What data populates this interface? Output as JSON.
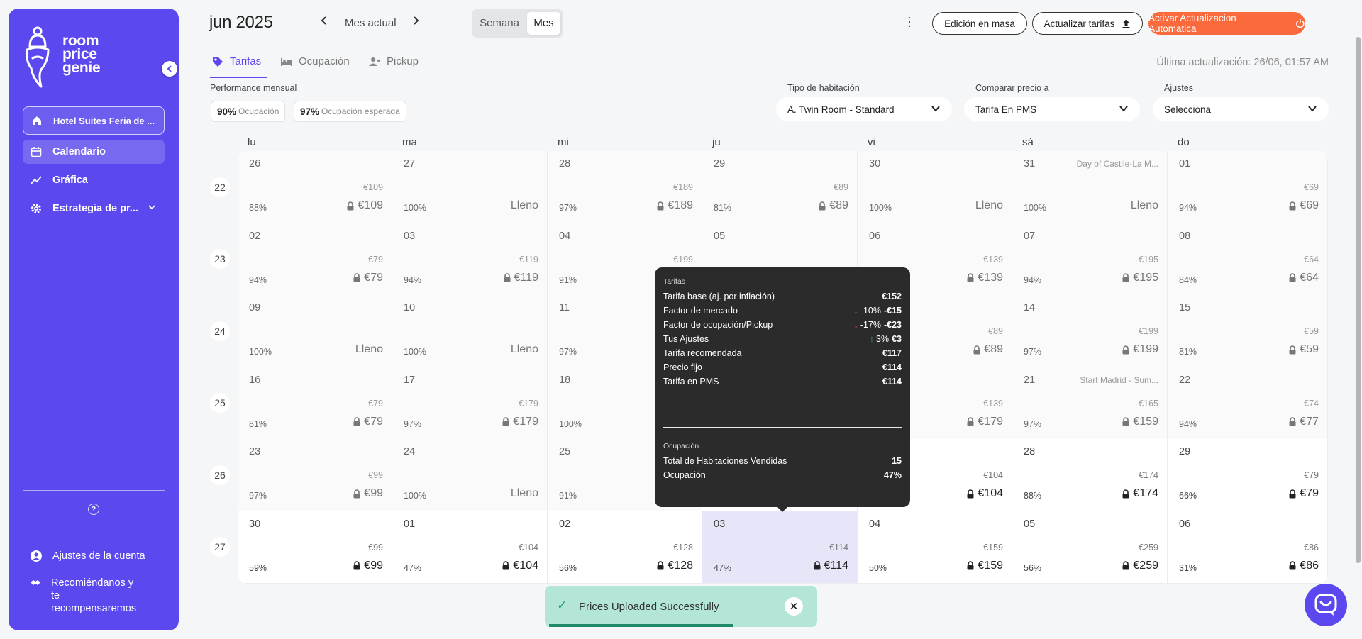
{
  "brand": {
    "lines": [
      "room",
      "price",
      "genie"
    ]
  },
  "sidebar": {
    "hotel": "Hotel Suites Feria de ...",
    "items": [
      {
        "label": "Calendario",
        "icon": "calendar-icon"
      },
      {
        "label": "Gráfica",
        "icon": "chart-line-icon"
      },
      {
        "label": "Estrategia de pr...",
        "icon": "gear-icon"
      }
    ],
    "bottom": [
      {
        "label": "Ajustes de la cuenta",
        "icon": "user-circle-icon"
      },
      {
        "label": "Recomiéndanos y te recompensaremos",
        "icon": "handshake-icon"
      }
    ],
    "help_glyph": "?"
  },
  "header": {
    "month": "jun 2025",
    "current_month": "Mes actual",
    "views": [
      "Semana",
      "Mes"
    ],
    "active_view": "Mes",
    "buttons": {
      "bulk_edit": "Edición en masa",
      "update_rates": "Actualizar tarifas",
      "auto_update": "Activar Actualizacion Automatica"
    },
    "last_update": "Última actualización: 26/06, 01:57 AM"
  },
  "tabs": [
    {
      "label": "Tarifas",
      "icon": "tag-icon"
    },
    {
      "label": "Ocupación",
      "icon": "bed-icon"
    },
    {
      "label": "Pickup",
      "icon": "user-plus-icon"
    }
  ],
  "filters": {
    "performance_label": "Performance mensual",
    "occupancy": {
      "value": "90%",
      "label": "Ocupación"
    },
    "expected_occupancy": {
      "value": "97%",
      "label": "Ocupación esperada"
    },
    "room_type": {
      "label": "Tipo de habitación",
      "value": "A. Twin Room - Standard"
    },
    "compare": {
      "label": "Comparar precio a",
      "value": "Tarifa En PMS"
    },
    "settings": {
      "label": "Ajustes",
      "value": "Selecciona"
    }
  },
  "calendar": {
    "day_names": [
      "lu",
      "ma",
      "mi",
      "ju",
      "vi",
      "sá",
      "do"
    ],
    "weeks": [
      {
        "num": "22",
        "days": [
          {
            "d": "26",
            "pms": "€109",
            "occ": "88%",
            "price": "€109",
            "lock": true,
            "past": true
          },
          {
            "d": "27",
            "pms": "",
            "occ": "100%",
            "price": "Lleno",
            "lock": false,
            "past": true
          },
          {
            "d": "28",
            "pms": "€189",
            "occ": "97%",
            "price": "€189",
            "lock": true,
            "past": true
          },
          {
            "d": "29",
            "pms": "€89",
            "occ": "81%",
            "price": "€89",
            "lock": true,
            "past": true
          },
          {
            "d": "30",
            "pms": "",
            "occ": "100%",
            "price": "Lleno",
            "lock": false,
            "past": true
          },
          {
            "d": "31",
            "pms": "",
            "occ": "100%",
            "price": "Lleno",
            "lock": false,
            "past": true,
            "event": "Day of Castile-La M..."
          },
          {
            "d": "01",
            "pms": "€69",
            "occ": "94%",
            "price": "€69",
            "lock": true,
            "past": true
          }
        ]
      },
      {
        "num": "23",
        "days": [
          {
            "d": "02",
            "pms": "€79",
            "occ": "94%",
            "price": "€79",
            "lock": true,
            "past": true
          },
          {
            "d": "03",
            "pms": "€119",
            "occ": "94%",
            "price": "€119",
            "lock": true,
            "past": true
          },
          {
            "d": "04",
            "pms": "€199",
            "occ": "91%",
            "price": "",
            "lock": false,
            "past": true
          },
          {
            "d": "05",
            "pms": "",
            "occ": "",
            "price": "",
            "lock": false,
            "past": true
          },
          {
            "d": "06",
            "pms": "€139",
            "occ": "",
            "price": "€139",
            "lock": true,
            "past": true
          },
          {
            "d": "07",
            "pms": "€195",
            "occ": "94%",
            "price": "€195",
            "lock": true,
            "past": true
          },
          {
            "d": "08",
            "pms": "€64",
            "occ": "84%",
            "price": "€64",
            "lock": true,
            "past": true
          }
        ]
      },
      {
        "num": "24",
        "days": [
          {
            "d": "09",
            "pms": "",
            "occ": "100%",
            "price": "Lleno",
            "lock": false,
            "past": true
          },
          {
            "d": "10",
            "pms": "",
            "occ": "100%",
            "price": "Lleno",
            "lock": false,
            "past": true
          },
          {
            "d": "11",
            "pms": "",
            "occ": "97%",
            "price": "",
            "lock": false,
            "past": true
          },
          {
            "d": "",
            "pms": "",
            "occ": "",
            "price": "",
            "lock": false,
            "past": true
          },
          {
            "d": "",
            "pms": "€89",
            "occ": "",
            "price": "€89",
            "lock": true,
            "past": true
          },
          {
            "d": "14",
            "pms": "€199",
            "occ": "97%",
            "price": "€199",
            "lock": true,
            "past": true
          },
          {
            "d": "15",
            "pms": "€59",
            "occ": "81%",
            "price": "€59",
            "lock": true,
            "past": true
          }
        ]
      },
      {
        "num": "25",
        "days": [
          {
            "d": "16",
            "pms": "€79",
            "occ": "81%",
            "price": "€79",
            "lock": true,
            "past": true
          },
          {
            "d": "17",
            "pms": "€179",
            "occ": "97%",
            "price": "€179",
            "lock": true,
            "past": true
          },
          {
            "d": "18",
            "pms": "",
            "occ": "100%",
            "price": "",
            "lock": false,
            "past": true
          },
          {
            "d": "",
            "pms": "",
            "occ": "",
            "price": "",
            "lock": false,
            "past": true
          },
          {
            "d": "",
            "pms": "€139",
            "occ": "",
            "price": "€179",
            "lock": true,
            "past": true
          },
          {
            "d": "21",
            "pms": "€165",
            "occ": "97%",
            "price": "€159",
            "lock": true,
            "past": true,
            "event": "Start Madrid - Sum..."
          },
          {
            "d": "22",
            "pms": "€74",
            "occ": "94%",
            "price": "€77",
            "lock": true,
            "past": true
          }
        ]
      },
      {
        "num": "26",
        "days": [
          {
            "d": "23",
            "pms": "€99",
            "occ": "97%",
            "price": "€99",
            "lock": true,
            "past": true
          },
          {
            "d": "24",
            "pms": "",
            "occ": "100%",
            "price": "Lleno",
            "lock": false,
            "past": true
          },
          {
            "d": "25",
            "pms": "",
            "occ": "91%",
            "price": "",
            "lock": false,
            "past": true
          },
          {
            "d": "",
            "pms": "",
            "occ": "",
            "price": "",
            "lock": false,
            "past": false
          },
          {
            "d": "",
            "pms": "€104",
            "occ": "",
            "price": "€104",
            "lock": true,
            "past": false
          },
          {
            "d": "28",
            "pms": "€174",
            "occ": "88%",
            "price": "€174",
            "lock": true,
            "past": false
          },
          {
            "d": "29",
            "pms": "€79",
            "occ": "66%",
            "price": "€79",
            "lock": true,
            "past": false
          }
        ]
      },
      {
        "num": "27",
        "days": [
          {
            "d": "30",
            "pms": "€99",
            "occ": "59%",
            "price": "€99",
            "lock": true,
            "past": false
          },
          {
            "d": "01",
            "pms": "€104",
            "occ": "47%",
            "price": "€104",
            "lock": true,
            "past": false
          },
          {
            "d": "02",
            "pms": "€128",
            "occ": "56%",
            "price": "€128",
            "lock": true,
            "past": false
          },
          {
            "d": "03",
            "pms": "€114",
            "occ": "47%",
            "price": "€114",
            "lock": true,
            "past": false,
            "selected": true
          },
          {
            "d": "04",
            "pms": "€159",
            "occ": "50%",
            "price": "€159",
            "lock": true,
            "past": false
          },
          {
            "d": "05",
            "pms": "€259",
            "occ": "56%",
            "price": "€259",
            "lock": true,
            "past": false
          },
          {
            "d": "06",
            "pms": "€86",
            "occ": "31%",
            "price": "€86",
            "lock": true,
            "past": false
          }
        ]
      }
    ]
  },
  "tooltip": {
    "rates_title": "Tarifas",
    "rows": [
      {
        "label": "Tarifa base (aj. por inflación)",
        "value": "€152"
      },
      {
        "label": "Factor de mercado",
        "dir": "down",
        "pct": "-10%",
        "value": "-€15"
      },
      {
        "label": "Factor de ocupación/Pickup",
        "dir": "down",
        "pct": "-17%",
        "value": "-€23"
      },
      {
        "label": "Tus Ajustes",
        "dir": "up",
        "pct": "3%",
        "value": "€3"
      },
      {
        "label": "Tarifa recomendada",
        "value": "€117"
      },
      {
        "label": "Precio fijo",
        "value": "€114"
      },
      {
        "label": "Tarifa en PMS",
        "value": "€114"
      }
    ],
    "occ_title": "Ocupación",
    "occ_rows": [
      {
        "label": "Total de Habitaciones Vendidas",
        "value": "15"
      },
      {
        "label": "Ocupación",
        "value": "47%"
      }
    ]
  },
  "toast": {
    "message": "Prices Uploaded Successfully",
    "check": "✓",
    "close": "✕",
    "progress": 0.7
  },
  "colors": {
    "accent": "#5b48ee",
    "orange": "#fb6a3d",
    "toast_bg": "#b3e6d7"
  }
}
